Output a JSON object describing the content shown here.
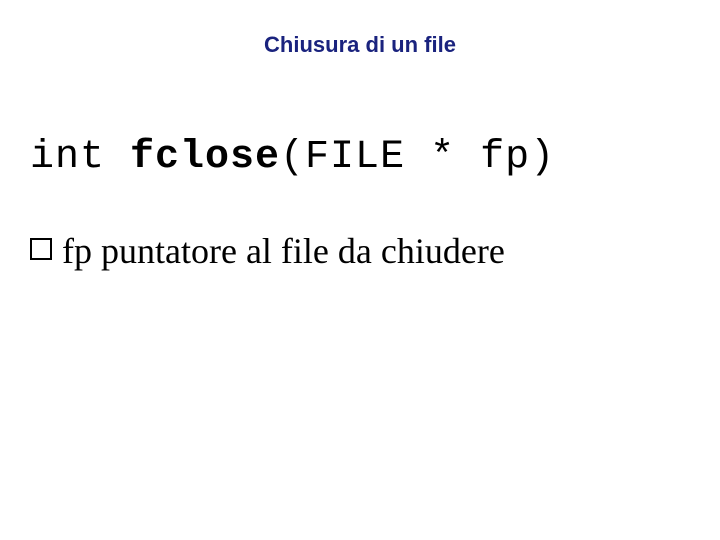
{
  "slide": {
    "title": "Chiusura di un file",
    "code": {
      "ret_type": "int ",
      "func_name": "fclose",
      "params": "(FILE * fp)"
    },
    "bullet1": " fp puntatore al file da chiudere"
  }
}
